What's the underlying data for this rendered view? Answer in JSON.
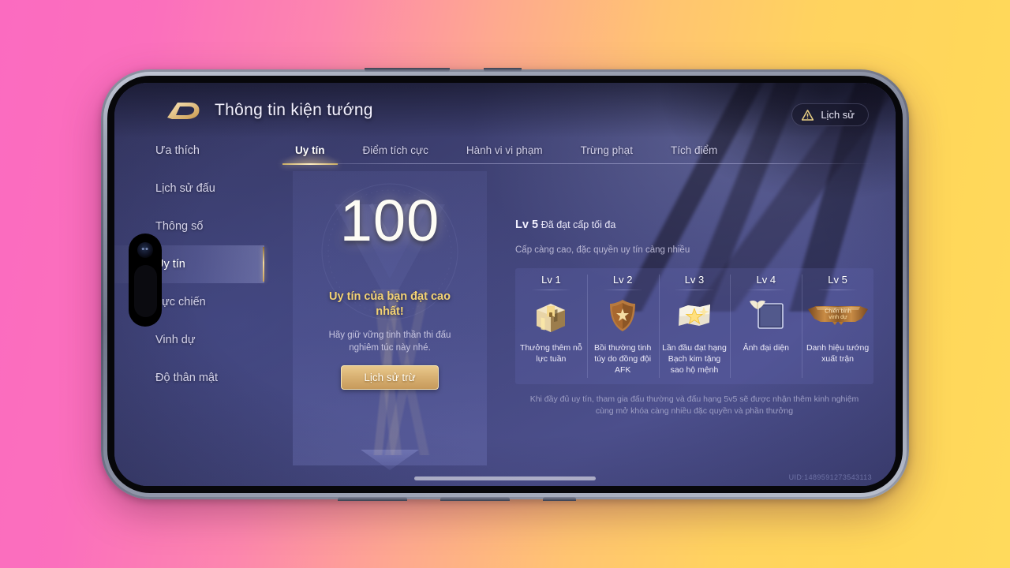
{
  "app": {
    "header": {
      "logo_icon": "honor-of-kings-d-logo",
      "title": "Thông tin kiện tướng",
      "history_button": {
        "label": "Lịch sử",
        "icon": "warning-triangle-icon"
      }
    },
    "sidebar": {
      "items": [
        {
          "label": "Ưa thích",
          "active": false
        },
        {
          "label": "Lịch sử đấu",
          "active": false
        },
        {
          "label": "Thông số",
          "active": false
        },
        {
          "label": "Uy tín",
          "active": true
        },
        {
          "label": "Lực chiến",
          "active": false
        },
        {
          "label": "Vinh dự",
          "active": false
        },
        {
          "label": "Độ thân mật",
          "active": false
        }
      ]
    },
    "tabs": [
      {
        "label": "Uy tín",
        "active": true
      },
      {
        "label": "Điểm tích cực",
        "active": false
      },
      {
        "label": "Hành vi vi phạm",
        "active": false
      },
      {
        "label": "Trừng phạt",
        "active": false
      },
      {
        "label": "Tích điểm",
        "active": false
      }
    ],
    "score_panel": {
      "badge_icon": "v-shield-watermark-icon",
      "score": "100",
      "headline": "Uy tín của bạn đạt cao nhất!",
      "sub": "Hãy giữ vững tinh thần thi đấu nghiêm túc này nhé.",
      "deduction_button": "Lịch sử trừ"
    },
    "level_info": {
      "level_label": "Lv 5",
      "level_status": "Đã đạt cấp tối đa",
      "description": "Cấp càng cao, đặc quyền uy tín càng nhiều",
      "cards": [
        {
          "title": "Lv 1",
          "icon": "treasure-chest-icon",
          "desc": "Thưởng thêm nỗ lực tuần"
        },
        {
          "title": "Lv 2",
          "icon": "bronze-shield-icon",
          "desc": "Bồi thường tinh túy do đồng đội AFK"
        },
        {
          "title": "Lv 3",
          "icon": "gold-star-card-icon",
          "desc": "Lần đầu đạt hạng Bạch kim tặng sao hộ mệnh"
        },
        {
          "title": "Lv 4",
          "icon": "avatar-frame-icon",
          "desc": "Ảnh đại diện"
        },
        {
          "title": "Lv 5",
          "icon": "honor-title-banner-icon",
          "desc": "Danh hiệu tướng xuất trận",
          "banner_text": "Chiến binh vinh dự"
        }
      ],
      "footer_note": "Khi đầy đủ uy tín, tham gia đấu thường và đấu hạng 5v5 sẽ được nhận thêm kinh nghiệm cùng mở khóa càng nhiều đặc quyền và phần thưởng"
    },
    "uid": "UID:1489591273543113"
  },
  "theme": {
    "accent_gold": "#f3d273",
    "panel_blue": "#4c4f8c",
    "bg_gradient_start": "#fb6bc0",
    "bg_gradient_end": "#ffd75a"
  }
}
